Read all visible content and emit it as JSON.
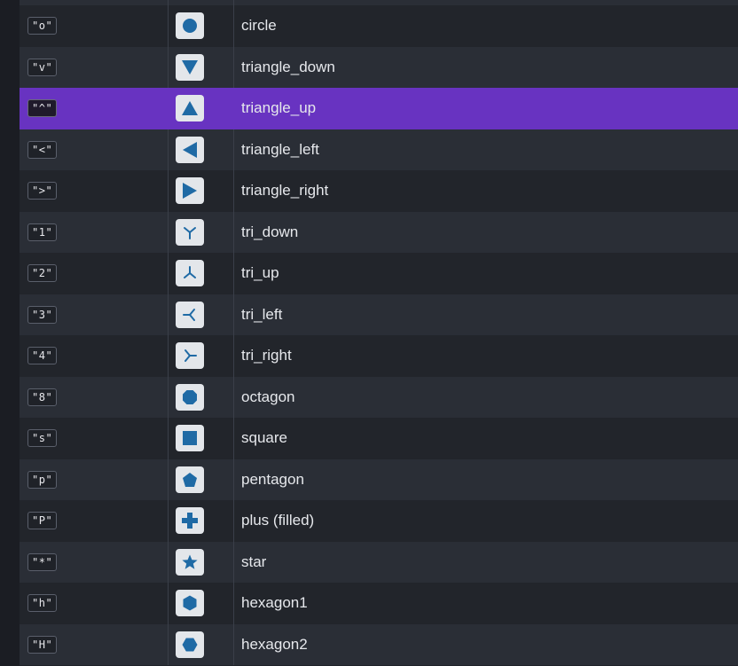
{
  "rows": [
    {
      "code": "\"o\"",
      "name": "circle",
      "icon": "circle-marker-icon"
    },
    {
      "code": "\"v\"",
      "name": "triangle_down",
      "icon": "triangle-down-marker-icon"
    },
    {
      "code": "\"^\"",
      "name": "triangle_up",
      "icon": "triangle-up-marker-icon",
      "selected": true
    },
    {
      "code": "\"<\"",
      "name": "triangle_left",
      "icon": "triangle-left-marker-icon"
    },
    {
      "code": "\">\"",
      "name": "triangle_right",
      "icon": "triangle-right-marker-icon"
    },
    {
      "code": "\"1\"",
      "name": "tri_down",
      "icon": "tri-down-marker-icon"
    },
    {
      "code": "\"2\"",
      "name": "tri_up",
      "icon": "tri-up-marker-icon"
    },
    {
      "code": "\"3\"",
      "name": "tri_left",
      "icon": "tri-left-marker-icon"
    },
    {
      "code": "\"4\"",
      "name": "tri_right",
      "icon": "tri-right-marker-icon"
    },
    {
      "code": "\"8\"",
      "name": "octagon",
      "icon": "octagon-marker-icon"
    },
    {
      "code": "\"s\"",
      "name": "square",
      "icon": "square-marker-icon"
    },
    {
      "code": "\"p\"",
      "name": "pentagon",
      "icon": "pentagon-marker-icon"
    },
    {
      "code": "\"P\"",
      "name": "plus (filled)",
      "icon": "plus-filled-marker-icon"
    },
    {
      "code": "\"*\"",
      "name": "star",
      "icon": "star-marker-icon"
    },
    {
      "code": "\"h\"",
      "name": "hexagon1",
      "icon": "hexagon1-marker-icon"
    },
    {
      "code": "\"H\"",
      "name": "hexagon2",
      "icon": "hexagon2-marker-icon"
    }
  ],
  "colors": {
    "marker_fill": "#1f6aa5",
    "selected_row": "#6833c1"
  }
}
